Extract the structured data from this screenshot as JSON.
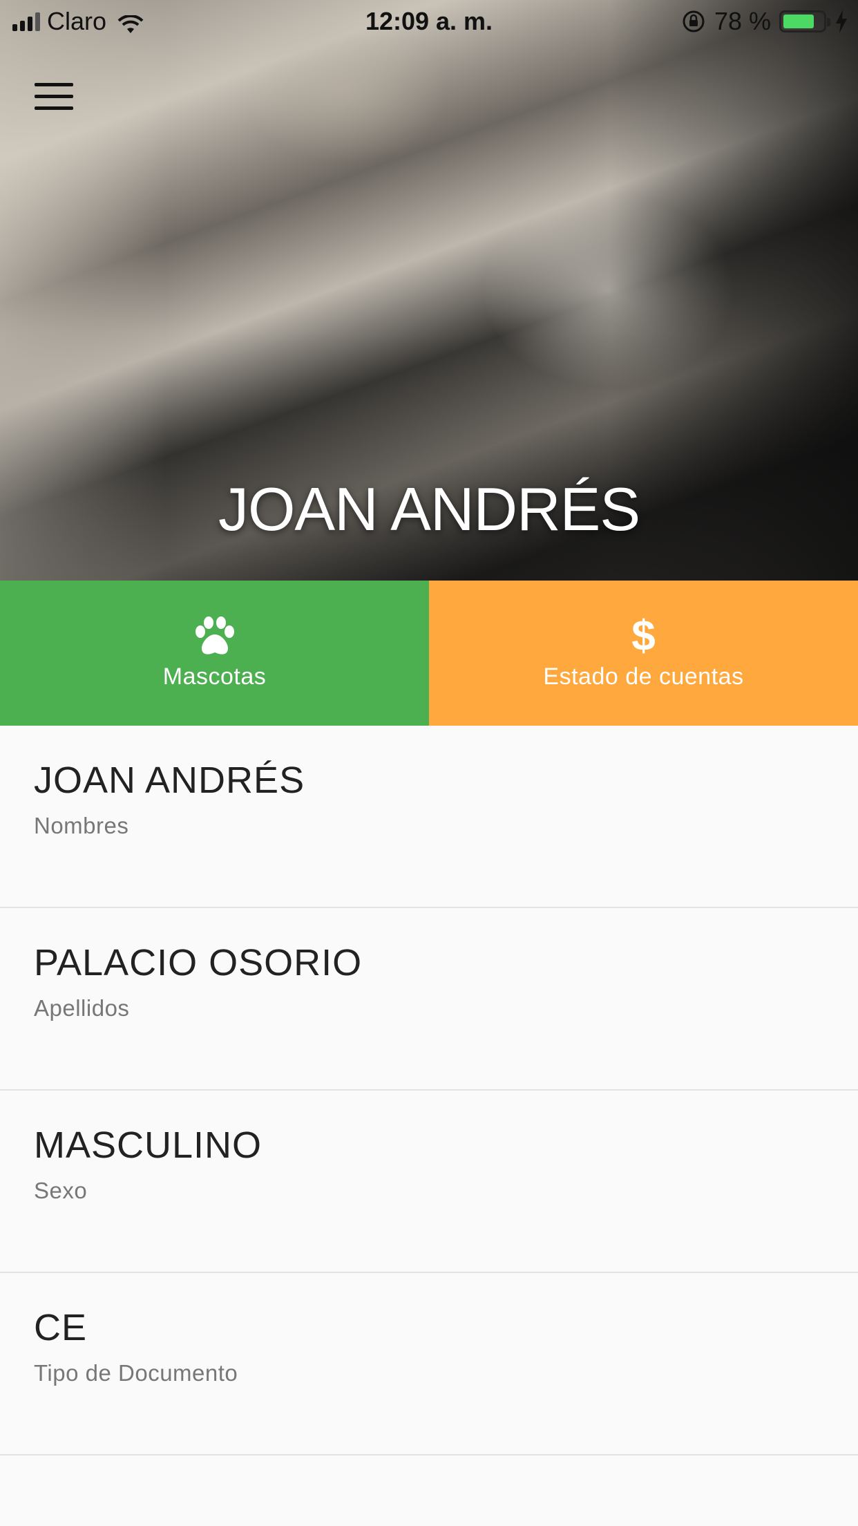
{
  "status_bar": {
    "carrier": "Claro",
    "time": "12:09 a. m.",
    "battery_percent": "78 %",
    "battery_level": 0.78
  },
  "profile": {
    "display_name": "JOAN ANDRÉS"
  },
  "actions": [
    {
      "label": "Mascotas",
      "icon": "paw-icon",
      "color": "#4caf50"
    },
    {
      "label": "Estado de cuentas",
      "icon": "dollar-icon",
      "icon_glyph": "$",
      "color": "#ffa83e"
    }
  ],
  "fields": [
    {
      "value": "JOAN ANDRÉS",
      "label": "Nombres"
    },
    {
      "value": "PALACIO OSORIO",
      "label": "Apellidos"
    },
    {
      "value": "MASCULINO",
      "label": "Sexo"
    },
    {
      "value": "CE",
      "label": "Tipo de Documento"
    }
  ]
}
